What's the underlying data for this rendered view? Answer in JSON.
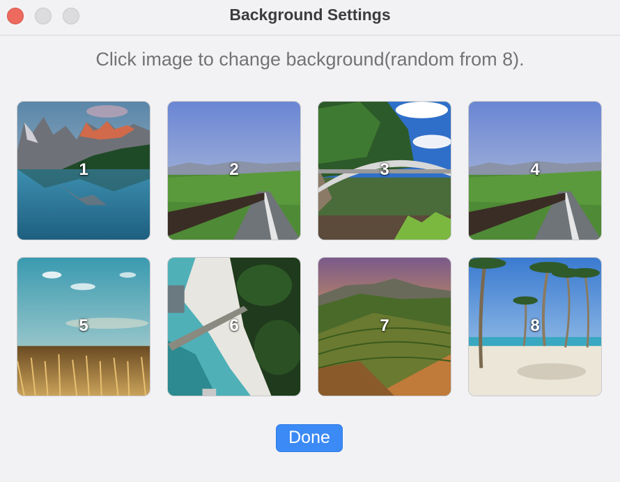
{
  "window": {
    "title": "Background Settings"
  },
  "instruction": "Click image to change background(random from 8).",
  "tiles": [
    {
      "label": "1",
      "scene": "mountain-lake"
    },
    {
      "label": "2",
      "scene": "country-road"
    },
    {
      "label": "3",
      "scene": "iron-bridge"
    },
    {
      "label": "4",
      "scene": "country-road"
    },
    {
      "label": "5",
      "scene": "wheat-field"
    },
    {
      "label": "6",
      "scene": "aerial-beach"
    },
    {
      "label": "7",
      "scene": "terraced-hills"
    },
    {
      "label": "8",
      "scene": "palm-beach"
    }
  ],
  "done_label": "Done",
  "colors": {
    "accent": "#3b8af5",
    "close": "#ee6a5e"
  }
}
